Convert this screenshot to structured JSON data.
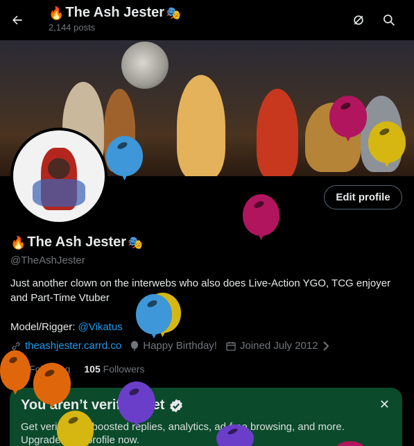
{
  "header": {
    "back_label": "Back",
    "title": "The Ash Jester",
    "title_prefix_emoji": "🔥",
    "title_suffix_emoji": "🎭",
    "posts_count": "2,144 posts"
  },
  "profile": {
    "display_name": "The Ash Jester",
    "name_prefix_emoji": "🔥",
    "name_suffix_emoji": "🎭",
    "handle": "@TheAshJester",
    "edit_button": "Edit profile",
    "bio_line1": "Just another clown on the interwebs who also does Live-Action YGO, TCG enjoyer and Part-Time Vtuber",
    "bio_model_label": "Model/Rigger: ",
    "bio_model_link": "@Vikatus",
    "website": "theashjester.carrd.co",
    "birthday": "Happy Birthday!",
    "joined": "Joined July 2012",
    "following_count": "244",
    "following_label": "Following",
    "followers_count": "105",
    "followers_label": "Followers"
  },
  "verify_card": {
    "title": "You aren’t verified yet",
    "text": "Get verified for boosted replies, analytics, ad-free browsing, and more. Upgrade your profile now."
  },
  "colors": {
    "accent": "#1d9bf0",
    "muted": "#71767b",
    "card_bg": "#0b4a2b",
    "balloon_magenta": "#b0155e",
    "balloon_blue": "#3d97d8",
    "balloon_yellow": "#d6b711",
    "balloon_orange": "#e0660b",
    "balloon_purple": "#6a3ec9"
  },
  "icons": [
    "arrow-left-icon",
    "refresh-off-icon",
    "search-icon",
    "link-icon",
    "balloon-icon",
    "calendar-icon",
    "chevron-right-icon",
    "verified-badge-icon",
    "close-icon"
  ]
}
